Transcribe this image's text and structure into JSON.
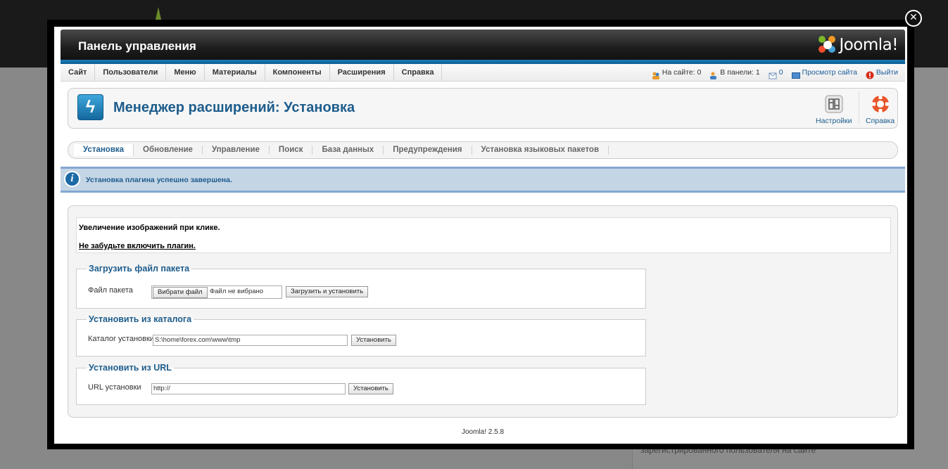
{
  "background": {
    "footer_text": "зарегистрированного пользователя на сайте"
  },
  "lightbox": {
    "close_glyph": "✕"
  },
  "header": {
    "title": "Панель управления",
    "brand": "Joomla!"
  },
  "menu": {
    "items": [
      {
        "label": "Сайт"
      },
      {
        "label": "Пользователи"
      },
      {
        "label": "Меню"
      },
      {
        "label": "Материалы"
      },
      {
        "label": "Компоненты"
      },
      {
        "label": "Расширения"
      },
      {
        "label": "Справка"
      }
    ]
  },
  "status": {
    "on_site": "На сайте: 0",
    "in_panel": "В панели: 1",
    "messages": "0",
    "view_site": "Просмотр сайта",
    "logout": "Выйти"
  },
  "toolbar": {
    "page_icon": "ϟ",
    "title": "Менеджер расширений: Установка",
    "options_label": "Настройки",
    "help_label": "Справка"
  },
  "tabs": [
    {
      "label": "Установка",
      "active": true
    },
    {
      "label": "Обновление"
    },
    {
      "label": "Управление"
    },
    {
      "label": "Поиск"
    },
    {
      "label": "База данных"
    },
    {
      "label": "Предупреждения"
    },
    {
      "label": "Установка языковых пакетов"
    }
  ],
  "message": {
    "icon": "i",
    "text": "Установка плагина успешно завершена."
  },
  "description": {
    "line1": "Увеличение изображений при клике.",
    "line2": "Не забудьте включить плагин."
  },
  "upload": {
    "legend": "Загрузить файл пакета",
    "label": "Файл пакета",
    "choose_button": "Вибрати файл",
    "file_status": "Файл не вибрано",
    "submit_button": "Загрузить и установить"
  },
  "folder": {
    "legend": "Установить из каталога",
    "label": "Каталог установки",
    "value": "S:\\home\\forex.com\\www\\tmp",
    "submit_button": "Установить"
  },
  "url": {
    "legend": "Установить из URL",
    "label": "URL установки",
    "value": "http://",
    "submit_button": "Установить"
  },
  "footer": {
    "version": "Joomla! 2.5.8"
  },
  "colors": {
    "accent_blue": "#1d5c8c",
    "header_dark": "#1e1e1e",
    "message_bg": "#c4d5e6"
  }
}
